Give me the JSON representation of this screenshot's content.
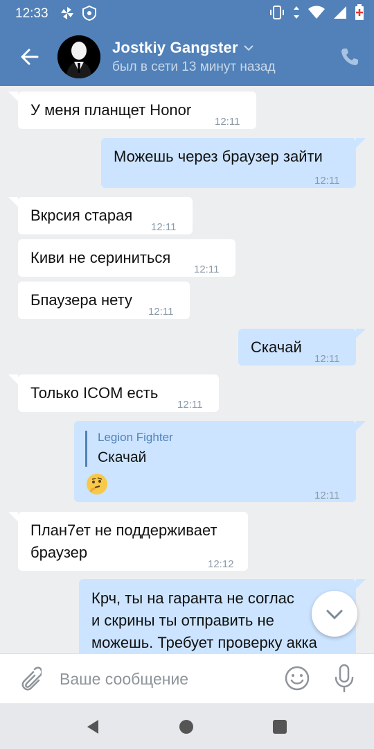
{
  "status_bar": {
    "time": "12:33",
    "left_icons": [
      "pinwheel-icon",
      "vk-notification-icon"
    ],
    "right_icons": [
      "vibrate-icon",
      "data-arrows-icon",
      "wifi-icon",
      "signal-icon",
      "battery-icon"
    ]
  },
  "header": {
    "name": "Jostkiy Gangster",
    "status": "был в сети 13 минут назад",
    "icons": [
      "back-arrow-icon",
      "chevron-down-icon",
      "phone-icon"
    ]
  },
  "messages": [
    {
      "direction": "in",
      "text": "У меня планщет Honor",
      "time": "12:11"
    },
    {
      "direction": "out",
      "text": "Можешь через браузер зайти",
      "time": "12:11"
    },
    {
      "direction": "in",
      "text": "Вкрсия старая",
      "time": "12:11"
    },
    {
      "direction": "in",
      "text": "Киви не сериниться",
      "time": "12:11"
    },
    {
      "direction": "in",
      "text": "Бпаузера нету",
      "time": "12:11"
    },
    {
      "direction": "out",
      "text": "Скачай",
      "time": "12:11"
    },
    {
      "direction": "in",
      "text": "Только ICOM есть",
      "time": "12:11"
    },
    {
      "direction": "out",
      "reply_author": "Legion Fighter",
      "reply_text": "Скачай",
      "emoji": "thinking-face-emoji",
      "time": "12:11"
    },
    {
      "direction": "in",
      "text_lines": [
        "План7ет не поддерживает",
        "браузер"
      ],
      "time": "12:12"
    },
    {
      "direction": "out",
      "text_lines": [
        "Крч, ты на гаранта не соглас",
        "и скрины ты отправить не",
        "можешь. Требует проверку акка"
      ]
    }
  ],
  "composer": {
    "placeholder": "Ваше сообщение",
    "icons": [
      "attach-icon",
      "emoji-icon",
      "microphone-icon"
    ]
  },
  "navbar": {
    "icons": [
      "nav-back-icon",
      "nav-home-icon",
      "nav-recents-icon"
    ]
  },
  "colors": {
    "header": "#5181b8",
    "background": "#edeef0",
    "bubble_out": "#cce4ff",
    "bubble_in": "#ffffff",
    "accent": "#5181b8"
  }
}
